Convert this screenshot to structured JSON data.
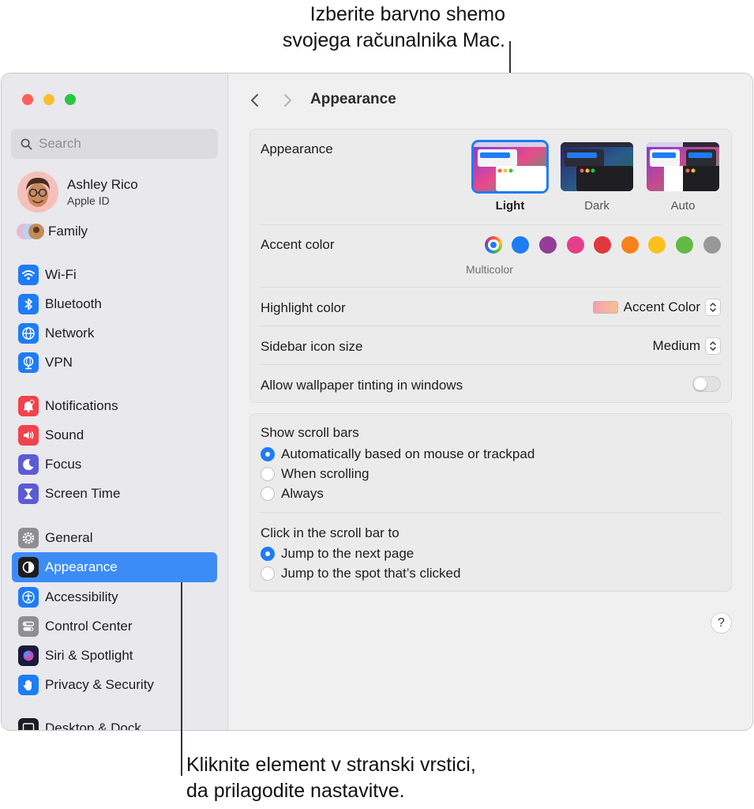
{
  "callouts": {
    "top_line1": "Izberite barvno shemo",
    "top_line2": "svojega računalnika Mac.",
    "bottom_line1": "Kliknite element v stranski vrstici,",
    "bottom_line2": "da prilagodite nastavitve."
  },
  "sidebar": {
    "search_placeholder": "Search",
    "profile": {
      "name": "Ashley Rico",
      "subtitle": "Apple ID"
    },
    "family_label": "Family",
    "items": [
      {
        "label": "Wi-Fi",
        "icon": "wifi-icon",
        "color": "#1e7cf5"
      },
      {
        "label": "Bluetooth",
        "icon": "bluetooth-icon",
        "color": "#1e7cf5"
      },
      {
        "label": "Network",
        "icon": "globe-icon",
        "color": "#1e7cf5"
      },
      {
        "label": "VPN",
        "icon": "vpn-globe-icon",
        "color": "#1e7cf5"
      },
      {
        "label": "Notifications",
        "icon": "bell-icon",
        "color": "#f0434b"
      },
      {
        "label": "Sound",
        "icon": "speaker-icon",
        "color": "#f0434b"
      },
      {
        "label": "Focus",
        "icon": "moon-icon",
        "color": "#5b5bd6"
      },
      {
        "label": "Screen Time",
        "icon": "hourglass-icon",
        "color": "#5b5bd6"
      },
      {
        "label": "General",
        "icon": "gear-icon",
        "color": "#8e8e93"
      },
      {
        "label": "Appearance",
        "icon": "appearance-icon",
        "color": "#1d1d1f"
      },
      {
        "label": "Accessibility",
        "icon": "accessibility-icon",
        "color": "#1e7cf5"
      },
      {
        "label": "Control Center",
        "icon": "control-center-icon",
        "color": "#8e8e93"
      },
      {
        "label": "Siri & Spotlight",
        "icon": "siri-icon",
        "color": "#2a2a5a"
      },
      {
        "label": "Privacy & Security",
        "icon": "hand-icon",
        "color": "#1e7cf5"
      },
      {
        "label": "Desktop & Dock",
        "icon": "dock-icon",
        "color": "#1d1d1f"
      }
    ],
    "selected": "Appearance"
  },
  "header": {
    "title": "Appearance"
  },
  "appearance": {
    "label": "Appearance",
    "options": [
      {
        "label": "Light",
        "selected": true
      },
      {
        "label": "Dark",
        "selected": false
      },
      {
        "label": "Auto",
        "selected": false
      }
    ],
    "accent_label": "Accent color",
    "accent_colors": [
      "multicolor",
      "#1e7cf5",
      "#953d96",
      "#e63e8b",
      "#e0383e",
      "#f7821b",
      "#fcc11c",
      "#62ba46",
      "#989898"
    ],
    "accent_selected_label": "Multicolor",
    "highlight_label": "Highlight color",
    "highlight_value": "Accent Color",
    "sidebar_size_label": "Sidebar icon size",
    "sidebar_size_value": "Medium",
    "tinting_label": "Allow wallpaper tinting in windows",
    "tinting_on": false
  },
  "scrollbars": {
    "show_label": "Show scroll bars",
    "show_options": [
      {
        "label": "Automatically based on mouse or trackpad",
        "selected": true
      },
      {
        "label": "When scrolling",
        "selected": false
      },
      {
        "label": "Always",
        "selected": false
      }
    ],
    "click_label": "Click in the scroll bar to",
    "click_options": [
      {
        "label": "Jump to the next page",
        "selected": true
      },
      {
        "label": "Jump to the spot that’s clicked",
        "selected": false
      }
    ]
  },
  "help_label": "?"
}
